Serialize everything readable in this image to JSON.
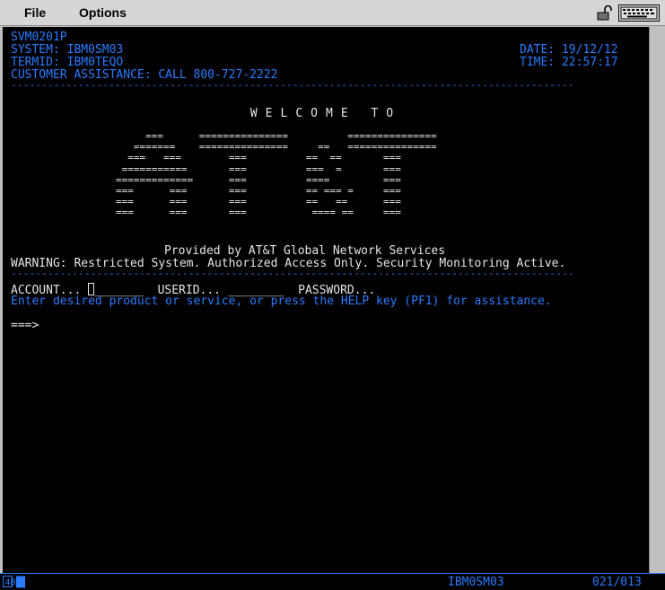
{
  "menu": {
    "file": "File",
    "options": "Options"
  },
  "header": {
    "screen_id": "SVM0201P",
    "system": "SYSTEM: IBM0SM03",
    "termid": "TERMID: IBM0TEQO",
    "assistance": "CUSTOMER ASSISTANCE: CALL 800-727-2222",
    "date": "DATE: 19/12/12",
    "time": "TIME: 22:57:17"
  },
  "separator": "--------------------------------------------------------------------------------------------",
  "welcome": "WELCOME TO",
  "logo_art": [
    "     ===      ===============          ===============",
    "   =======    ===============     ==   ===============",
    "  ===   ===        ===          ==  ==       ===",
    " ===========       ===          ===  =       ===",
    "=============      ===          ====         ===",
    "===      ===       ===          == === =     ===",
    "===      ===       ===          ==   ==      ===",
    "===      ===       ===           ==== ==     ==="
  ],
  "provided_by": "Provided by AT&T Global Network Services",
  "warning": "WARNING: Restricted System. Authorized Access Only. Security Monitoring Active.",
  "login": {
    "account_label": "ACCOUNT...",
    "account_value": "_______",
    "userid_label": "USERID...",
    "userid_value": "________",
    "password_label": "PASSWORD..."
  },
  "instructions": "Enter desired product or service, or press the HELP key (PF1) for assistance.",
  "command_prompt": "===>",
  "status": {
    "indicator": "4B",
    "system": "IBM0SM03",
    "cursor_pos": "021/013"
  },
  "colors": {
    "terminal_bg": "#000000",
    "cyan_text": "#2b7bff",
    "white_text": "#e6e6e6",
    "chrome": "#d6d6d6"
  },
  "icons": {
    "lock": "lock-open-icon",
    "keyboard": "keyboard-icon"
  }
}
